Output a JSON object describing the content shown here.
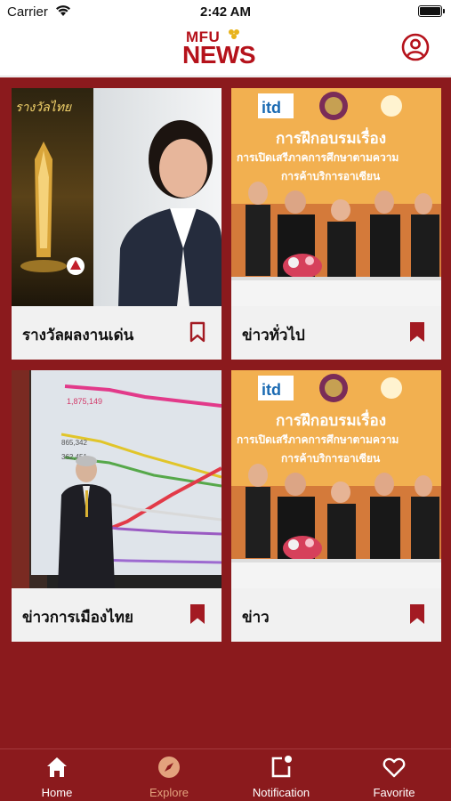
{
  "status_bar": {
    "carrier": "Carrier",
    "time": "2:42 AM"
  },
  "header": {
    "logo_top": "MFU",
    "logo_main": "NEWS",
    "profile_icon": "user-circle-icon"
  },
  "cards": [
    {
      "label": "รางวัลผลงานเด่น",
      "bookmarked": false
    },
    {
      "label": "ข่าวทั่วไป",
      "bookmarked": true
    },
    {
      "label": "ข่าวการเมืองไทย",
      "bookmarked": true
    },
    {
      "label": "ข่าว",
      "bookmarked": true
    }
  ],
  "images": {
    "award_poster_text": "รางวัลไทย",
    "seminar_banner_line1": "การฝึกอบรมเรื่อง",
    "seminar_banner_line2": "การเปิดเสรีภาคการศึกษาตามความ",
    "seminar_banner_line3": "การค้าบริการอาเซียน",
    "seminar_logo": "itd"
  },
  "tabs": [
    {
      "label": "Home",
      "icon": "home-icon",
      "active": true
    },
    {
      "label": "Explore",
      "icon": "compass-icon",
      "active": false
    },
    {
      "label": "Notification",
      "icon": "notification-icon",
      "active": true
    },
    {
      "label": "Favorite",
      "icon": "heart-icon",
      "active": true
    }
  ],
  "colors": {
    "brand": "#b5121b",
    "background": "#8b1a1d",
    "inactive_tab": "#e3a27d",
    "card": "#f1f1f1"
  }
}
